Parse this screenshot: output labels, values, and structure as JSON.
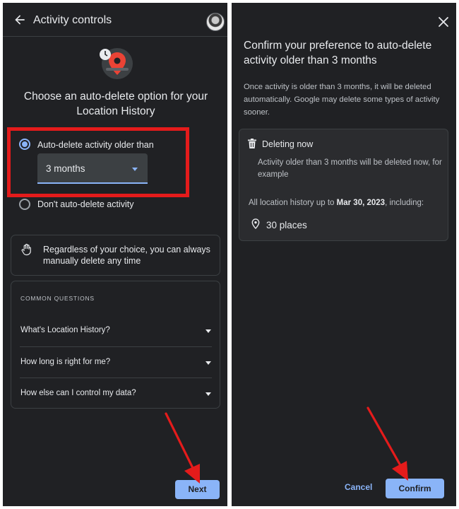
{
  "left": {
    "header": {
      "title": "Activity controls"
    },
    "heading": "Choose an auto-delete option for your Location History",
    "options": {
      "auto_delete_label": "Auto-delete activity older than",
      "selected_duration": "3 months",
      "dont_auto_delete_label": "Don't auto-delete activity"
    },
    "note": "Regardless of your choice, you can always manually delete any time",
    "faq": {
      "heading": "COMMON QUESTIONS",
      "items": [
        {
          "label": "What's Location History?"
        },
        {
          "label": "How long is right for me?"
        },
        {
          "label": "How else can I control my data?"
        }
      ]
    },
    "next_label": "Next"
  },
  "right": {
    "title": "Confirm your preference to auto-delete activity older than 3 months",
    "description": "Once activity is older than 3 months, it will be deleted automatically. Google may delete some types of activity sooner.",
    "card": {
      "title": "Deleting now",
      "description": "Activity older than 3 months will be deleted now, for example",
      "history_prefix": "All location history up to ",
      "history_date": "Mar 30, 2023",
      "history_suffix": ", including:",
      "places": "30 places"
    },
    "cancel_label": "Cancel",
    "confirm_label": "Confirm"
  },
  "colors": {
    "background": "#202124",
    "accent": "#8ab4f8",
    "highlight": "#e41b1b",
    "divider": "#3c4043"
  },
  "icons": [
    "back-arrow-icon",
    "avatar",
    "location-history-illustration",
    "hand-icon",
    "chevron-down-icon",
    "close-icon",
    "trash-icon",
    "location-pin-icon"
  ]
}
